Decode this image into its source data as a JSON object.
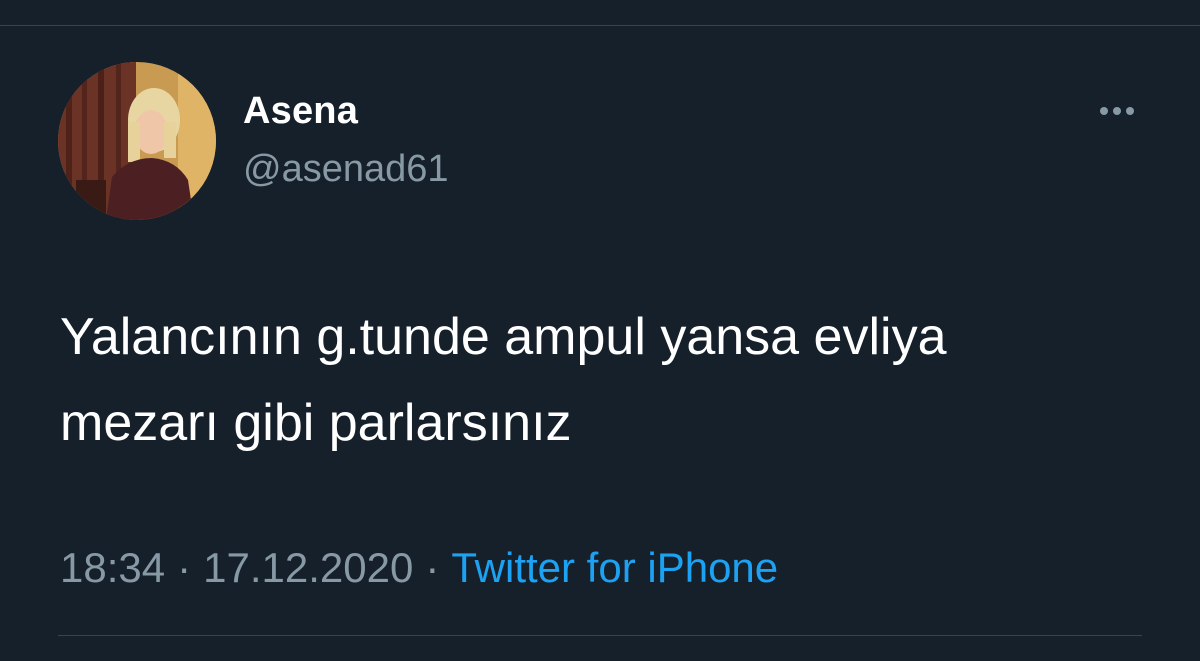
{
  "tweet": {
    "author": {
      "name": "Asena",
      "handle": "@asenad61",
      "avatar": "profile-photo"
    },
    "menu_icon": "more-dots-icon",
    "text": "Yalancının g.tunde ampul yansa evliya\nmezarı gibi parlarsınız",
    "time": "18:34",
    "date": "17.12.2020",
    "separator": "·",
    "source": "Twitter for iPhone"
  },
  "colors": {
    "background": "#15202b",
    "text_primary": "#ffffff",
    "text_secondary": "#8899a6",
    "link": "#1da1f2",
    "divider": "#38444d"
  }
}
